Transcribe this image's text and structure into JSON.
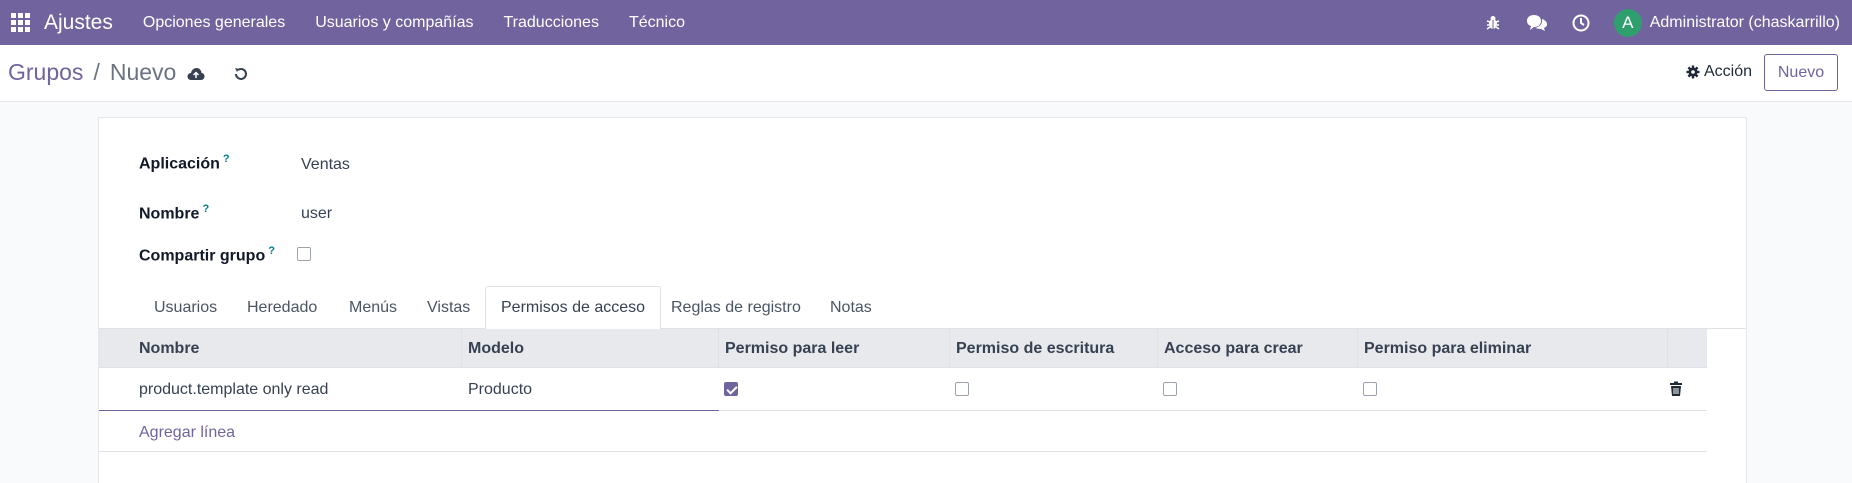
{
  "navbar": {
    "brand": "Ajustes",
    "menu": [
      "Opciones generales",
      "Usuarios y compañías",
      "Traducciones",
      "Técnico"
    ],
    "avatar_letter": "A",
    "user_name": "Administrator (chaskarrillo)",
    "accent": "#71639e"
  },
  "control": {
    "breadcrumb_parent": "Grupos",
    "breadcrumb_sep": "/",
    "breadcrumb_current": "Nuevo",
    "action_label": "Acción",
    "new_label": "Nuevo"
  },
  "form": {
    "application_label": "Aplicación",
    "application_value": "Ventas",
    "name_label": "Nombre",
    "name_value": "user",
    "share_label": "Compartir grupo",
    "help_mark": "?"
  },
  "tabs": [
    "Usuarios",
    "Heredado",
    "Menús",
    "Vistas",
    "Permisos de acceso",
    "Reglas de registro",
    "Notas"
  ],
  "table": {
    "columns": [
      "Nombre",
      "Modelo",
      "Permiso para leer",
      "Permiso de escritura",
      "Acceso para crear",
      "Permiso para eliminar"
    ],
    "rows": [
      {
        "name": "product.template only read",
        "model": "Producto",
        "read": true,
        "write": false,
        "create": false,
        "unlink": false
      }
    ],
    "add_line": "Agregar línea"
  }
}
